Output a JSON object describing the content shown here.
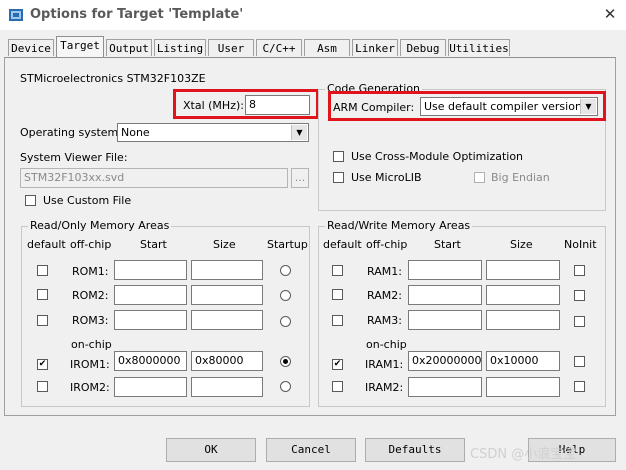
{
  "window": {
    "title": "Options for Target 'Template'",
    "close_glyph": "✕"
  },
  "tabs": [
    "Device",
    "Target",
    "Output",
    "Listing",
    "User",
    "C/C++",
    "Asm",
    "Linker",
    "Debug",
    "Utilities"
  ],
  "active_tab": "Target",
  "target": {
    "device_name": "STMicroelectronics STM32F103ZE",
    "xtal_label": "Xtal (MHz):",
    "xtal_value": "8",
    "os_label": "Operating system:",
    "os_value": "None",
    "svd_label": "System Viewer File:",
    "svd_value": "STM32F103xx.svd",
    "browse_label": "...",
    "custom_file_label": "Use Custom File"
  },
  "codegen": {
    "title": "Code Generation",
    "compiler_label": "ARM Compiler:",
    "compiler_value": "Use default compiler version",
    "cross_module_label": "Use Cross-Module Optimization",
    "microlib_label": "Use MicroLIB",
    "big_endian_label": "Big Endian"
  },
  "rom": {
    "title": "Read/Only Memory Areas",
    "headers": {
      "default": "default",
      "offchip": "off-chip",
      "start": "Start",
      "size": "Size",
      "startup": "Startup"
    },
    "onchip_label": "on-chip",
    "rows": [
      {
        "name": "ROM1:",
        "start": "",
        "size": "",
        "default": false,
        "startup": false
      },
      {
        "name": "ROM2:",
        "start": "",
        "size": "",
        "default": false,
        "startup": false
      },
      {
        "name": "ROM3:",
        "start": "",
        "size": "",
        "default": false,
        "startup": false
      },
      {
        "name": "IROM1:",
        "start": "0x8000000",
        "size": "0x80000",
        "default": true,
        "startup": true
      },
      {
        "name": "IROM2:",
        "start": "",
        "size": "",
        "default": false,
        "startup": false
      }
    ]
  },
  "ram": {
    "title": "Read/Write Memory Areas",
    "headers": {
      "default": "default",
      "offchip": "off-chip",
      "start": "Start",
      "size": "Size",
      "noinit": "NoInit"
    },
    "onchip_label": "on-chip",
    "rows": [
      {
        "name": "RAM1:",
        "start": "",
        "size": "",
        "default": false,
        "noinit": false
      },
      {
        "name": "RAM2:",
        "start": "",
        "size": "",
        "default": false,
        "noinit": false
      },
      {
        "name": "RAM3:",
        "start": "",
        "size": "",
        "default": false,
        "noinit": false
      },
      {
        "name": "IRAM1:",
        "start": "0x20000000",
        "size": "0x10000",
        "default": true,
        "noinit": false
      },
      {
        "name": "IRAM2:",
        "start": "",
        "size": "",
        "default": false,
        "noinit": false
      }
    ]
  },
  "buttons": {
    "ok": "OK",
    "cancel": "Cancel",
    "defaults": "Defaults",
    "help": "Help"
  },
  "watermark": "CSDN @小浪宝宝",
  "colors": {
    "highlight": "#e0141c"
  }
}
